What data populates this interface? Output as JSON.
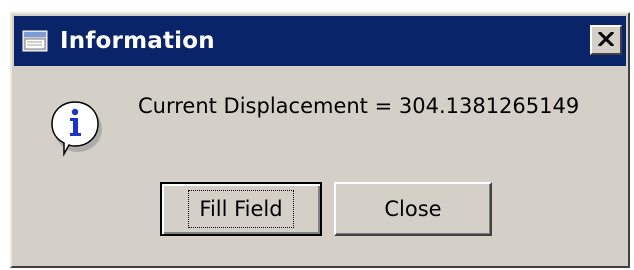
{
  "window": {
    "title": "Information",
    "title_icon": "window-app-icon",
    "close_glyph": "✕"
  },
  "message": {
    "icon": "info-icon",
    "text": "Current Displacement = 304.1381265149"
  },
  "buttons": {
    "fill_field_label": "Fill Field",
    "close_label": "Close"
  },
  "colors": {
    "titlebar": "#0a246a",
    "dialog_bg": "#d4d0c8",
    "info_icon_glyph": "#1a33c8"
  }
}
